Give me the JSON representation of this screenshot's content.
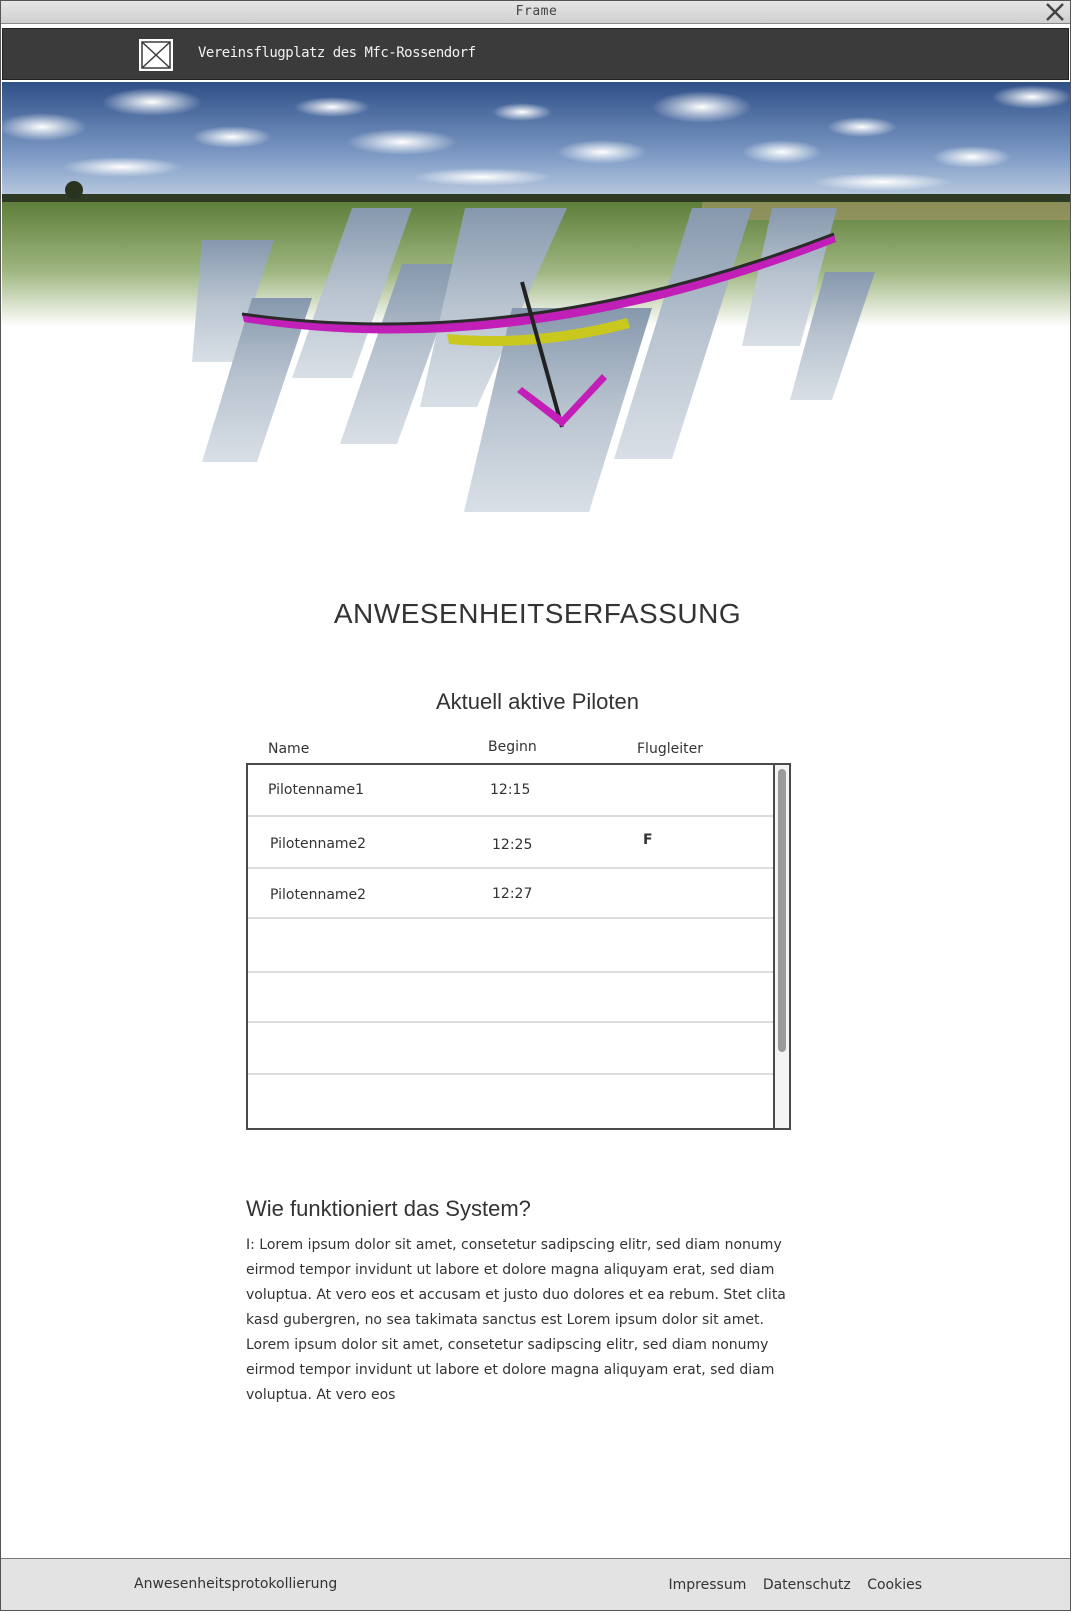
{
  "window": {
    "title": "Frame"
  },
  "header": {
    "site_name": "Vereinsflugplatz des Mfc-Rossendorf"
  },
  "main": {
    "title": "ANWESENHEITSERFASSUNG",
    "subtitle": "Aktuell aktive Piloten"
  },
  "table": {
    "columns": [
      "Name",
      "Beginn",
      "Flugleiter"
    ],
    "rows": [
      {
        "name": "Pilotenname1",
        "beginn": "12:15",
        "flugleiter": ""
      },
      {
        "name": "Pilotenname2",
        "beginn": "12:25",
        "flugleiter": "F"
      },
      {
        "name": "Pilotenname2",
        "beginn": "12:27",
        "flugleiter": ""
      },
      {
        "name": "",
        "beginn": "",
        "flugleiter": ""
      },
      {
        "name": "",
        "beginn": "",
        "flugleiter": ""
      },
      {
        "name": "",
        "beginn": "",
        "flugleiter": ""
      },
      {
        "name": "",
        "beginn": "",
        "flugleiter": ""
      }
    ]
  },
  "info": {
    "title": "Wie funktioniert das System?",
    "text": "I: Lorem ipsum dolor sit amet, consetetur sadipscing elitr, sed diam nonumy eirmod tempor invidunt ut labore et dolore magna aliquyam erat, sed diam voluptua. At vero eos et accusam et justo duo dolores et ea rebum. Stet clita kasd gubergren, no sea takimata sanctus est Lorem ipsum dolor sit amet. Lorem ipsum dolor sit amet, consetetur sadipscing elitr, sed diam nonumy eirmod tempor invidunt ut labore et dolore magna aliquyam erat, sed diam voluptua. At vero eos"
  },
  "footer": {
    "brand": "Anwesenheitsprotokollierung",
    "links": [
      "Impressum",
      "Datenschutz",
      "Cookies"
    ]
  },
  "colors": {
    "topbar": "#3b3b3b",
    "footer": "#e3e3e3",
    "glider_wing": "#c21fb8",
    "glider_center": "#c8c81e"
  }
}
